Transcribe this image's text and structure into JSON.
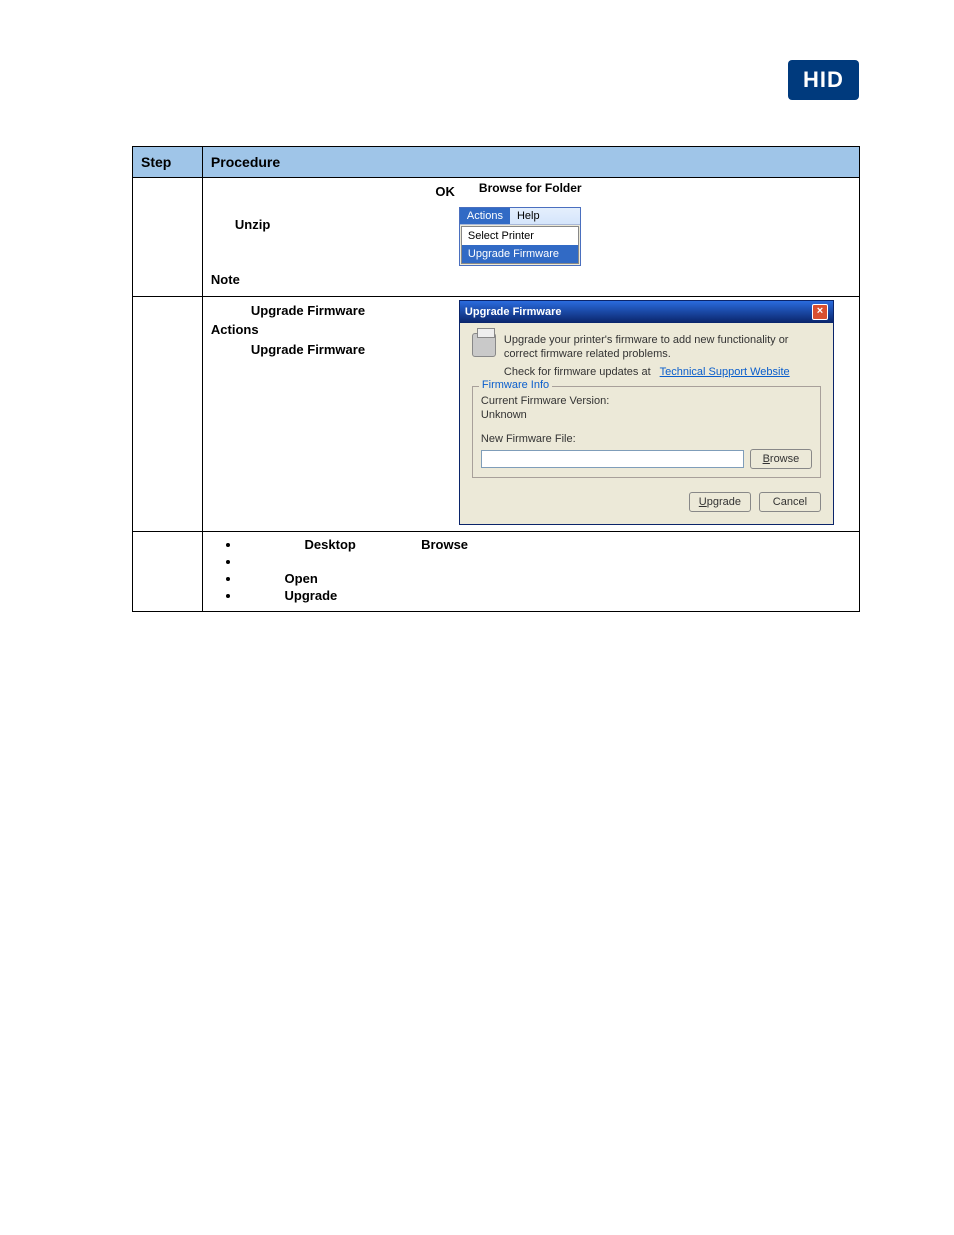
{
  "logo": {
    "text": "HID"
  },
  "table": {
    "headers": {
      "step": "Step",
      "procedure": "Procedure"
    },
    "rows": [
      {
        "left": {
          "ok": "OK",
          "browse_folder": "Browse for Folder",
          "unzip": "Unzip",
          "note": "Note"
        },
        "menu": {
          "actions": "Actions",
          "help": "Help",
          "select_printer": "Select Printer",
          "upgrade_firmware": "Upgrade Firmware"
        }
      },
      {
        "left": {
          "upgrade_firmware_1": "Upgrade Firmware",
          "actions": "Actions",
          "upgrade_firmware_2": "Upgrade Firmware"
        },
        "dialog": {
          "title": "Upgrade Firmware",
          "desc": "Upgrade your printer's firmware to add new functionality or correct firmware related problems.",
          "check_prefix": "Check for firmware updates at",
          "check_link": "Technical Support Website",
          "firmware_info_legend": "Firmware Info",
          "current_version_label": "Current Firmware Version:",
          "current_version_value": "Unknown",
          "new_file_label": "New Firmware File:",
          "browse_btn_u": "B",
          "browse_btn_rest": "rowse",
          "upgrade_btn_u": "U",
          "upgrade_btn_rest": "pgrade",
          "cancel_btn": "Cancel"
        }
      },
      {
        "bullets": {
          "desktop": "Desktop",
          "browse": "Browse",
          "open": "Open",
          "upgrade": "Upgrade"
        }
      }
    ]
  }
}
